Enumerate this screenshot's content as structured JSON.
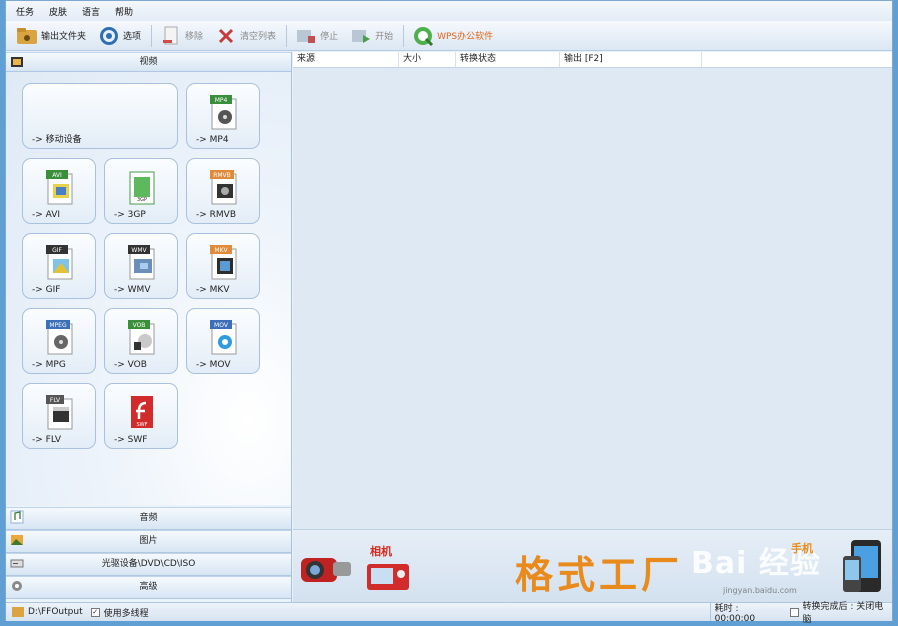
{
  "menu": [
    "任务",
    "皮肤",
    "语言",
    "帮助"
  ],
  "toolbar": {
    "output_folder": "输出文件夹",
    "options": "选项",
    "remove": "移除",
    "clear_list": "清空列表",
    "stop": "停止",
    "start": "开始",
    "wps": "WPS办公软件"
  },
  "left": {
    "video_header": "视频",
    "tiles": [
      {
        "label": "-> 移动设备",
        "icon": "mobile-device-icon"
      },
      {
        "label": "-> MP4",
        "badge": "MP4",
        "icon": "mp4-file-icon"
      },
      {
        "label": "-> AVI",
        "badge": "AVI",
        "icon": "avi-file-icon"
      },
      {
        "label": "-> 3GP",
        "badge": "3GP",
        "icon": "3gp-file-icon"
      },
      {
        "label": "-> RMVB",
        "badge": "RMVB",
        "icon": "rmvb-file-icon"
      },
      {
        "label": "-> GIF",
        "badge": "GIF",
        "icon": "gif-file-icon"
      },
      {
        "label": "-> WMV",
        "badge": "WMV",
        "icon": "wmv-file-icon"
      },
      {
        "label": "-> MKV",
        "badge": "MKV",
        "icon": "mkv-file-icon"
      },
      {
        "label": "-> MPG",
        "badge": "MPEG",
        "icon": "mpg-file-icon"
      },
      {
        "label": "-> VOB",
        "badge": "VOB",
        "icon": "vob-file-icon"
      },
      {
        "label": "-> MOV",
        "badge": "MOV",
        "icon": "mov-file-icon"
      },
      {
        "label": "-> FLV",
        "badge": "FLV",
        "icon": "flv-file-icon"
      },
      {
        "label": "-> SWF",
        "badge": "SWF",
        "icon": "swf-file-icon"
      }
    ],
    "categories": [
      "音频",
      "图片",
      "光驱设备\\DVD\\CD\\ISO",
      "高级"
    ]
  },
  "list": {
    "columns": [
      "来源",
      "大小",
      "转换状态",
      "输出 [F2]"
    ]
  },
  "banner": {
    "brand": "格式工厂",
    "camera_label": "相机",
    "phone_label": "手机",
    "watermark": "Bai 经验",
    "watermark_url": "jingyan.baidu.com"
  },
  "status": {
    "output_path": "D:\\FFOutput",
    "multithread": "使用多线程",
    "elapsed": "耗时 : 00:00:00",
    "after_convert": "转换完成后 : 关闭电脑"
  },
  "colors": {
    "accent": "#e98a1c",
    "window_bg": "#e8f0f8",
    "border": "#7fa8d0"
  }
}
